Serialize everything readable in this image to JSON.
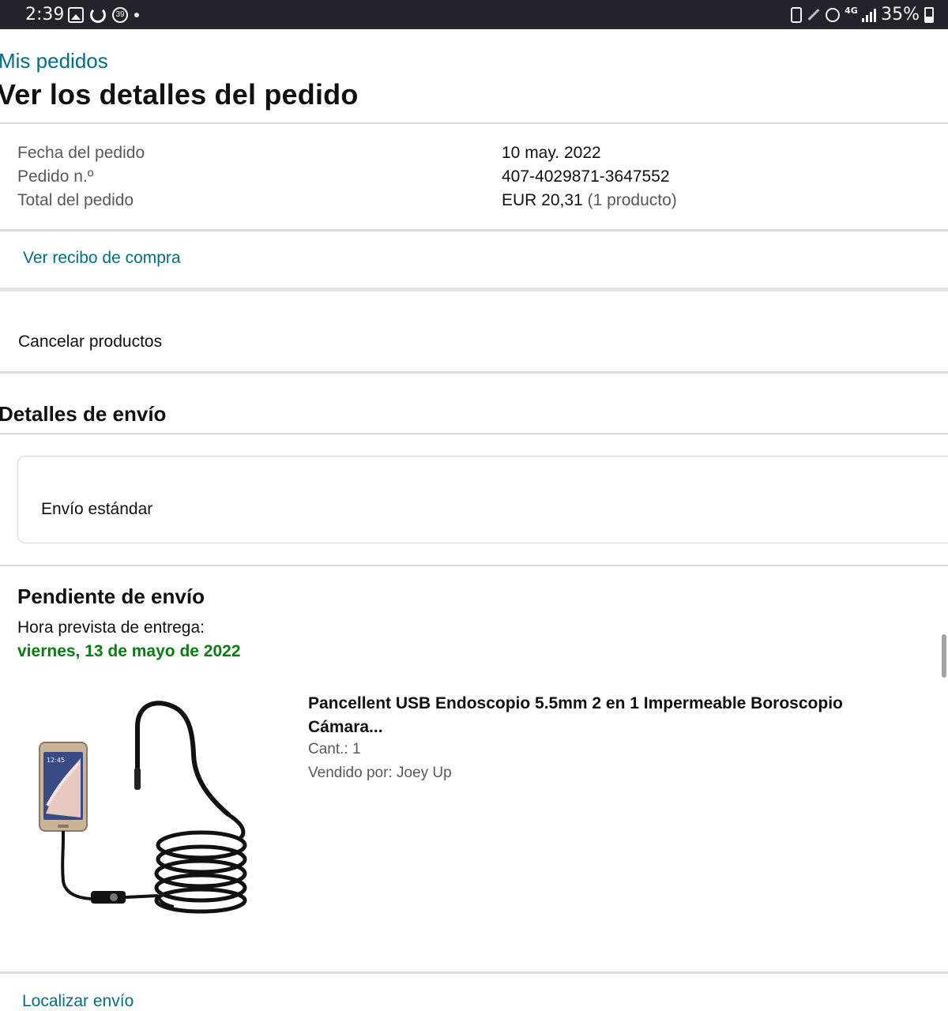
{
  "status_bar": {
    "time": "2:39",
    "battery_text": "35%",
    "network": "4G",
    "notification_badge": "39",
    "left_icons": [
      "gallery-icon",
      "refresh-icon",
      "badge-39-icon",
      "dot-icon"
    ],
    "right_icons": [
      "battery-saver-icon",
      "pen-icon",
      "alarm-icon",
      "network-4g-icon",
      "signal-icon",
      "battery-icon"
    ]
  },
  "header": {
    "breadcrumb": "Mis pedidos",
    "title": "Ver los detalles del pedido"
  },
  "order_info": {
    "labels": {
      "date": "Fecha del pedido",
      "number": "Pedido n.º",
      "total": "Total del pedido"
    },
    "values": {
      "date": "10 may. 2022",
      "number": "407-4029871-3647552",
      "total_amount": "EUR 20,31",
      "total_count": "(1 producto)"
    }
  },
  "actions": {
    "receipt_link": "Ver recibo de compra",
    "cancel_products": "Cancelar productos"
  },
  "shipping": {
    "section_title": "Detalles de envío",
    "method": "Envío estándar"
  },
  "shipment": {
    "status": "Pendiente de envío",
    "eta_label": "Hora prevista de entrega:",
    "eta_date": "viernes, 13 de mayo de 2022",
    "item": {
      "title": "Pancellent USB Endoscopio 5.5mm 2 en 1 Impermeable Boroscopio Cámara...",
      "quantity": "Cant.: 1",
      "seller": "Vendido por: Joey Up",
      "phone_screen_time": "12:45"
    },
    "track_link": "Localizar envío"
  },
  "colors": {
    "link": "#007185",
    "eta_green": "#0a7d12",
    "status_bar": "#23232b",
    "muted_text": "#565959"
  }
}
